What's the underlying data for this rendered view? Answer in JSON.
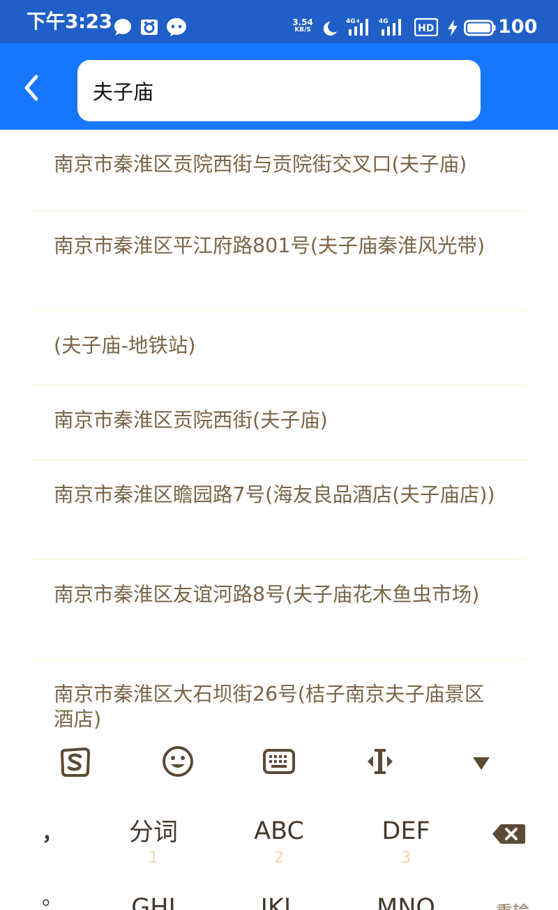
{
  "status_bar": {
    "time": "下午3:23",
    "net_speed": "3.54",
    "net_speed_unit": "KB/S",
    "network_label_1": "4G+",
    "network_label_2": "4G",
    "hd_label": "HD",
    "battery": "100",
    "colors": {
      "background": "#1f5fc7"
    }
  },
  "search": {
    "query": "夫子庙",
    "header_color": "#1677fd"
  },
  "results": [
    "南京市秦淮区贡院西街与贡院街交叉口(夫子庙)",
    "南京市秦淮区平江府路801号(夫子庙秦淮风光带)",
    "(夫子庙-地铁站)",
    "南京市秦淮区贡院西街(夫子庙)",
    "南京市秦淮区瞻园路7号(海友良品酒店(夫子庙店))",
    "南京市秦淮区友谊河路8号(夫子庙花木鱼虫市场)",
    "南京市秦淮区大石坝街26号(桔子南京夫子庙景区酒店)"
  ],
  "keyboard": {
    "toolbar": [
      "sogou-logo-icon",
      "emoji-icon",
      "keyboard-icon",
      "cursor-move-icon",
      "collapse-keyboard-icon"
    ],
    "punct_comma": "，",
    "punct_period": "。",
    "keys": [
      {
        "label": "分词",
        "num": "1"
      },
      {
        "label": "ABC",
        "num": "2"
      },
      {
        "label": "DEF",
        "num": "3"
      }
    ],
    "partial_keys": [
      "GHI",
      "JKL",
      "MNO",
      "重输"
    ],
    "colors": {
      "text": "#45392c",
      "number": "#f2d6a9"
    }
  }
}
